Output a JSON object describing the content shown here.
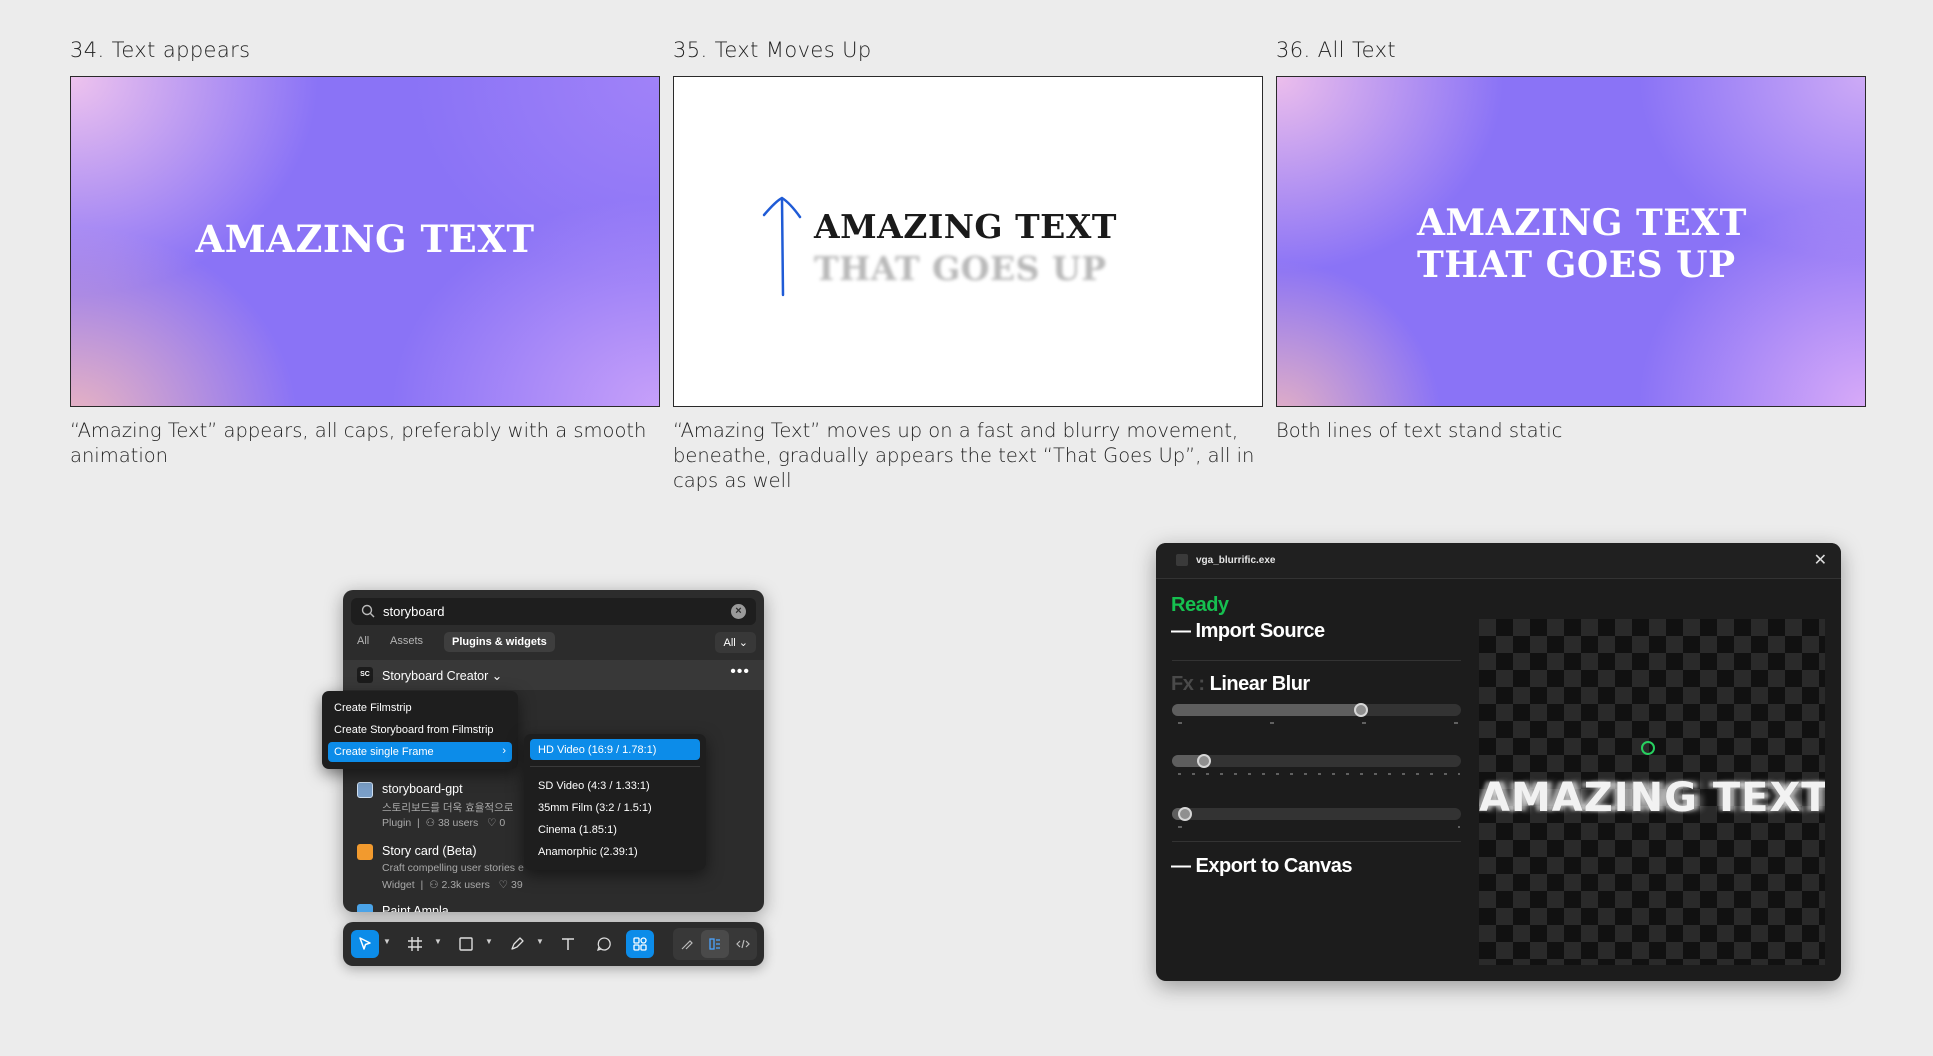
{
  "steps": [
    {
      "title": "34. Text appears",
      "line1": "AMAZING TEXT",
      "caption": "“Amazing Text” appears, all caps, preferably with a smooth animation"
    },
    {
      "title": "35. Text Moves Up",
      "line1": "AMAZING TEXT",
      "line2": "THAT GOES UP",
      "caption": "“Amazing Text” moves up on a fast and blurry movement, beneathe, gradually appears the text “That Goes Up”, all in caps as well"
    },
    {
      "title": "36. All Text",
      "line1": "AMAZING TEXT",
      "line2": "THAT GOES UP",
      "caption": "Both lines of text stand static"
    }
  ],
  "figma": {
    "search_value": "storyboard",
    "tabs": [
      "All",
      "Assets",
      "Plugins & widgets"
    ],
    "filter": "All",
    "plugin_logo": "SC",
    "plugin_name": "Storyboard Creator",
    "context_menu": [
      "Create Filmstrip",
      "Create Storyboard from Filmstrip",
      "Create single Frame"
    ],
    "submenu": [
      "HD Video (16:9 / 1.78:1)",
      "SD Video (4:3 / 1.33:1)",
      "35mm Film (3:2 / 1.5:1)",
      "Cinema (1.85:1)",
      "Anamorphic (2.39:1)"
    ],
    "results": [
      {
        "name": "storyboard-gpt",
        "desc": "스토리보드를 더욱 효율적으로",
        "type": "Plugin",
        "users": "38 users",
        "likes": "0"
      },
      {
        "name": "Story card (Beta)",
        "desc": "Craft compelling user stories e",
        "type": "Widget",
        "users": "2.3k users",
        "likes": "39"
      },
      {
        "name": "Paint Ampla"
      }
    ]
  },
  "vga": {
    "title": "vga_blurrific.exe",
    "status": "Ready",
    "import": "— Import Source",
    "fx_prefix": "Fx :",
    "fx_name": "Linear Blur",
    "export": "— Export to Canvas",
    "preview_text": "AMAZING TEXT",
    "sliders": [
      0.66,
      0.09,
      0.02
    ],
    "colors": {
      "status": "#16c050",
      "accent": "#0c8ce9"
    }
  }
}
